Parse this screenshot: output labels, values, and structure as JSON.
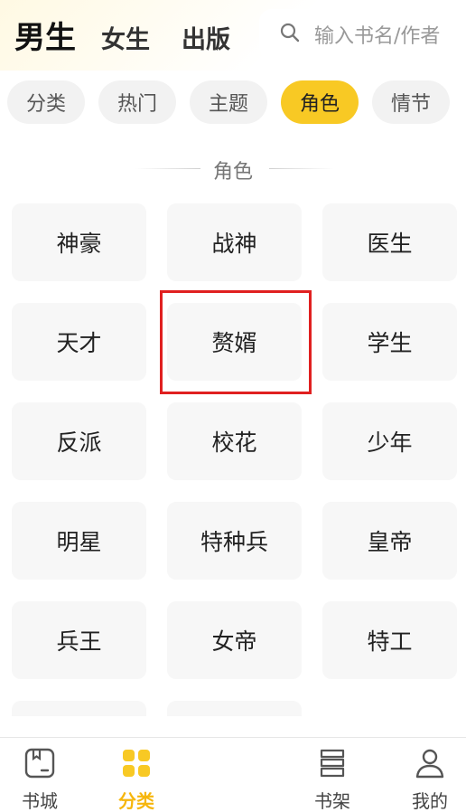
{
  "gender_tabs": [
    {
      "label": "男生",
      "active": true
    },
    {
      "label": "女生",
      "active": false
    },
    {
      "label": "出版",
      "active": false
    }
  ],
  "search": {
    "placeholder": "输入书名/作者",
    "icon": "search-icon"
  },
  "chips": [
    {
      "label": "分类",
      "active": false
    },
    {
      "label": "热门",
      "active": false
    },
    {
      "label": "主题",
      "active": false
    },
    {
      "label": "角色",
      "active": true
    },
    {
      "label": "情节",
      "active": false
    }
  ],
  "section": {
    "title": "角色"
  },
  "roles": [
    "神豪",
    "战神",
    "医生",
    "天才",
    "赘婿",
    "学生",
    "反派",
    "校花",
    "少年",
    "明星",
    "特种兵",
    "皇帝",
    "兵王",
    "女帝",
    "特工",
    "",
    ""
  ],
  "highlighted_role": "赘婿",
  "bottom_nav": [
    {
      "label": "书城",
      "icon": "book-city-icon",
      "active": false
    },
    {
      "label": "分类",
      "icon": "category-grid-icon",
      "active": true
    },
    {
      "label": "书架",
      "icon": "bookshelf-icon",
      "active": false
    },
    {
      "label": "我的",
      "icon": "profile-icon",
      "active": false
    }
  ],
  "colors": {
    "accent": "#f8c924",
    "nav_active": "#f6b60d",
    "highlight_border": "#e02020"
  }
}
